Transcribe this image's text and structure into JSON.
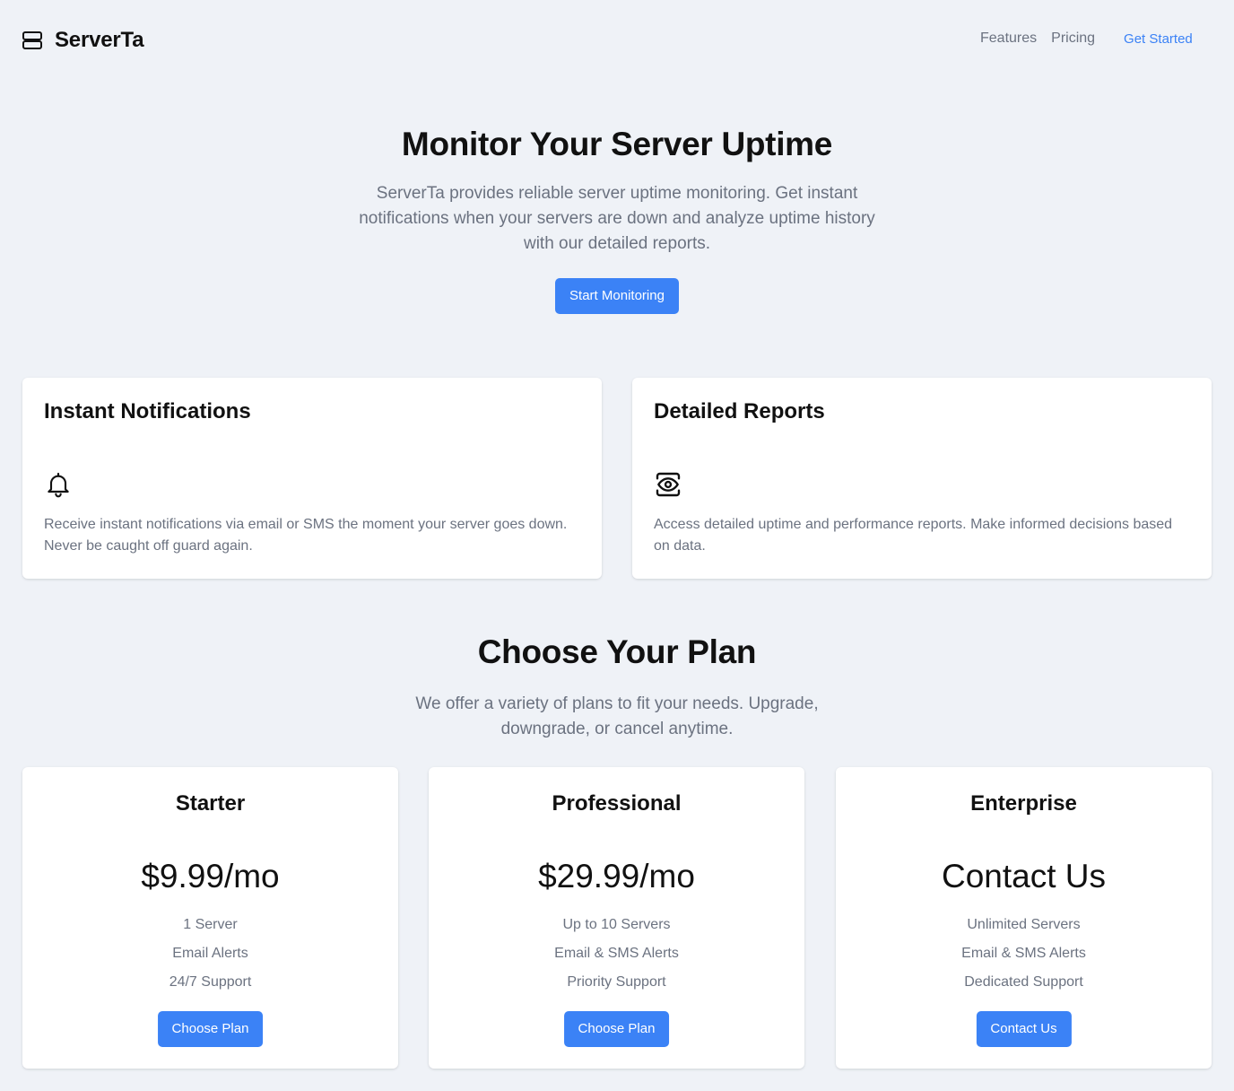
{
  "header": {
    "brand": "ServerTa",
    "nav": {
      "features": "Features",
      "pricing": "Pricing",
      "get_started": "Get Started"
    }
  },
  "hero": {
    "title": "Monitor Your Server Uptime",
    "description": "ServerTa provides reliable server uptime monitoring. Get instant notifications when your servers are down and analyze uptime history with our detailed reports.",
    "cta": "Start Monitoring"
  },
  "features": [
    {
      "title": "Instant Notifications",
      "icon": "bell-icon",
      "description": "Receive instant notifications via email or SMS the moment your server goes down. Never be caught off guard again."
    },
    {
      "title": "Detailed Reports",
      "icon": "eye-icon",
      "description": "Access detailed uptime and performance reports. Make informed decisions based on data."
    }
  ],
  "plans_section": {
    "title": "Choose Your Plan",
    "description": "We offer a variety of plans to fit your needs. Upgrade, downgrade, or cancel anytime."
  },
  "plans": [
    {
      "name": "Starter",
      "price": "$9.99/mo",
      "features": [
        "1 Server",
        "Email Alerts",
        "24/7 Support"
      ],
      "button": "Choose Plan"
    },
    {
      "name": "Professional",
      "price": "$29.99/mo",
      "features": [
        "Up to 10 Servers",
        "Email & SMS Alerts",
        "Priority Support"
      ],
      "button": "Choose Plan"
    },
    {
      "name": "Enterprise",
      "price": "Contact Us",
      "features": [
        "Unlimited Servers",
        "Email & SMS Alerts",
        "Dedicated Support"
      ],
      "button": "Contact Us"
    }
  ],
  "colors": {
    "accent": "#3b82f6",
    "background": "#eff2f7",
    "muted_text": "#6b7280"
  }
}
